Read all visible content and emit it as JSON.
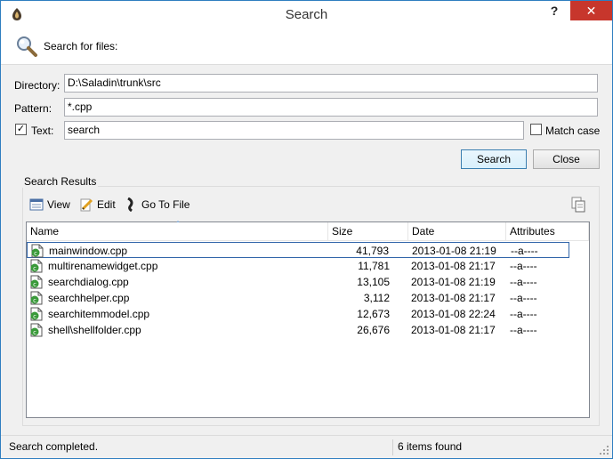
{
  "window": {
    "title": "Search",
    "help": "?",
    "close": "✕"
  },
  "banner": {
    "text": "Search for files:"
  },
  "form": {
    "directory_label": "Directory:",
    "directory_value": "D:\\Saladin\\trunk\\src",
    "pattern_label": "Pattern:",
    "pattern_value": "*.cpp",
    "text_label": "Text:",
    "text_checked": true,
    "text_value": "search",
    "match_case_label": "Match case",
    "match_case_checked": false
  },
  "buttons": {
    "search": "Search",
    "close": "Close"
  },
  "results": {
    "group_title": "Search Results",
    "toolbar": {
      "view": "View",
      "edit": "Edit",
      "goto": "Go To File"
    },
    "columns": [
      "Name",
      "Size",
      "Date",
      "Attributes"
    ],
    "sort_column": "Name",
    "rows": [
      {
        "name": "mainwindow.cpp",
        "size": "41,793",
        "date": "2013-01-08 21:19",
        "attributes": "--a----"
      },
      {
        "name": "multirenamewidget.cpp",
        "size": "11,781",
        "date": "2013-01-08 21:17",
        "attributes": "--a----"
      },
      {
        "name": "searchdialog.cpp",
        "size": "13,105",
        "date": "2013-01-08 21:19",
        "attributes": "--a----"
      },
      {
        "name": "searchhelper.cpp",
        "size": "3,112",
        "date": "2013-01-08 21:17",
        "attributes": "--a----"
      },
      {
        "name": "searchitemmodel.cpp",
        "size": "12,673",
        "date": "2013-01-08 22:24",
        "attributes": "--a----"
      },
      {
        "name": "shell\\shellfolder.cpp",
        "size": "26,676",
        "date": "2013-01-08 21:17",
        "attributes": "--a----"
      }
    ],
    "selected_index": 0
  },
  "status": {
    "left": "Search completed.",
    "right": "6 items found"
  },
  "colors": {
    "accent": "#3c7fb1",
    "close_button": "#c7362c",
    "selection": "#3366aa"
  }
}
